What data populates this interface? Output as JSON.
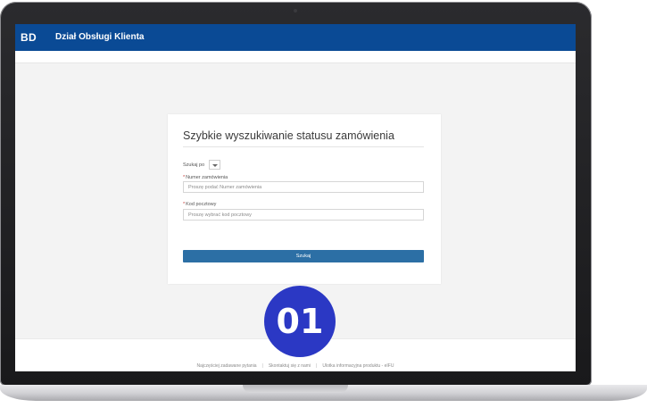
{
  "header": {
    "brand": "BD",
    "title": "Dział Obsługi Klienta"
  },
  "form": {
    "title": "Szybkie wyszukiwanie statusu zamówienia",
    "search_by_label": "Szukaj po",
    "order_number": {
      "label": "Numer zamówienia",
      "placeholder": "Proszę podać Numer zamówienia"
    },
    "postal_code": {
      "label": "Kod pocztowy",
      "placeholder": "Proszę wybrać kod pocztowy"
    },
    "submit_label": "Szukaj"
  },
  "footer": {
    "links": [
      "Najczęściej zadawane pytania",
      "Skontaktuj się z nami",
      "Ulotka informacyjna produktu - eIFU"
    ],
    "separator": "|"
  },
  "badge": {
    "text": "01"
  },
  "colors": {
    "header_bg": "#0a4a95",
    "button_bg": "#2c6fa5",
    "badge_bg": "#2b38c4"
  }
}
